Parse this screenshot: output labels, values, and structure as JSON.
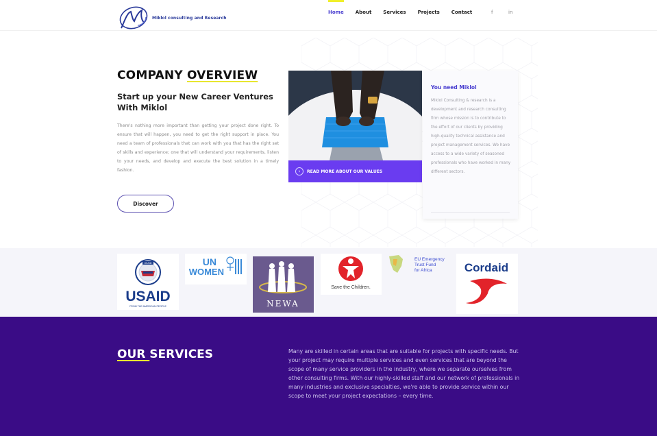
{
  "header": {
    "logo_text": "Miklol consulting and Research",
    "nav": [
      {
        "label": "Home",
        "active": true
      },
      {
        "label": "About",
        "active": false
      },
      {
        "label": "Services",
        "active": false
      },
      {
        "label": "Projects",
        "active": false
      },
      {
        "label": "Contact",
        "active": false
      }
    ],
    "social": {
      "facebook": "f",
      "linkedin": "in"
    }
  },
  "overview": {
    "title_plain": "COMPANY ",
    "title_highlight": "OVERVIEW",
    "subtitle": "Start up your New Career Ventures With Miklol",
    "paragraph": "There's nothing more important than getting your project done right. To ensure that will happen, you need to get the right support in place. You need a team of professionals that can work with you that has the right set of skills and experience; one that will understand your requirements, listen to your needs, and develop and execute the best solution in a timely fashion.",
    "discover_label": "Discover",
    "read_more_label": "READ MORE ABOUT OUR VALUES"
  },
  "card": {
    "title": "You need Miklol",
    "text": "Miklol Consulting & research is a development and research consulting firm whose mission is to contribute to the effort of our clients by providing high-quality technical assistance and project management services. We have access to a wide variety of seasoned professionals who have worked in many different sectors."
  },
  "partners": {
    "usaid": {
      "name": "USAID",
      "tagline": "FROM THE AMERICAN PEOPLE",
      "seal_text": "USAID"
    },
    "unwomen": {
      "un": "UN",
      "women": "WOMEN"
    },
    "newa": {
      "name": "NEWA"
    },
    "savethechildren": {
      "name": "Save the Children."
    },
    "eu": {
      "name": "EU Emergency Trust Fund for Africa"
    },
    "cordaid": {
      "name": "Cordaid"
    }
  },
  "services": {
    "title_highlight": "OUR ",
    "title_plain": "SERVICES",
    "text": "Many are skilled in certain areas that are suitable for projects with specific needs. But your project may require multiple services and even services that are beyond the scope of many service providers in the industry, where we separate ourselves from other consulting firms. With our highly-skilled staff and our network of professionals in many industries and exclusive specialties, we're able to provide service within our scope to meet your project expectations – every time."
  },
  "colors": {
    "accent": "#4a3fd0",
    "highlight": "#e8e630",
    "button_purple": "#6a3cf0",
    "services_bg": "#3a0c86"
  }
}
